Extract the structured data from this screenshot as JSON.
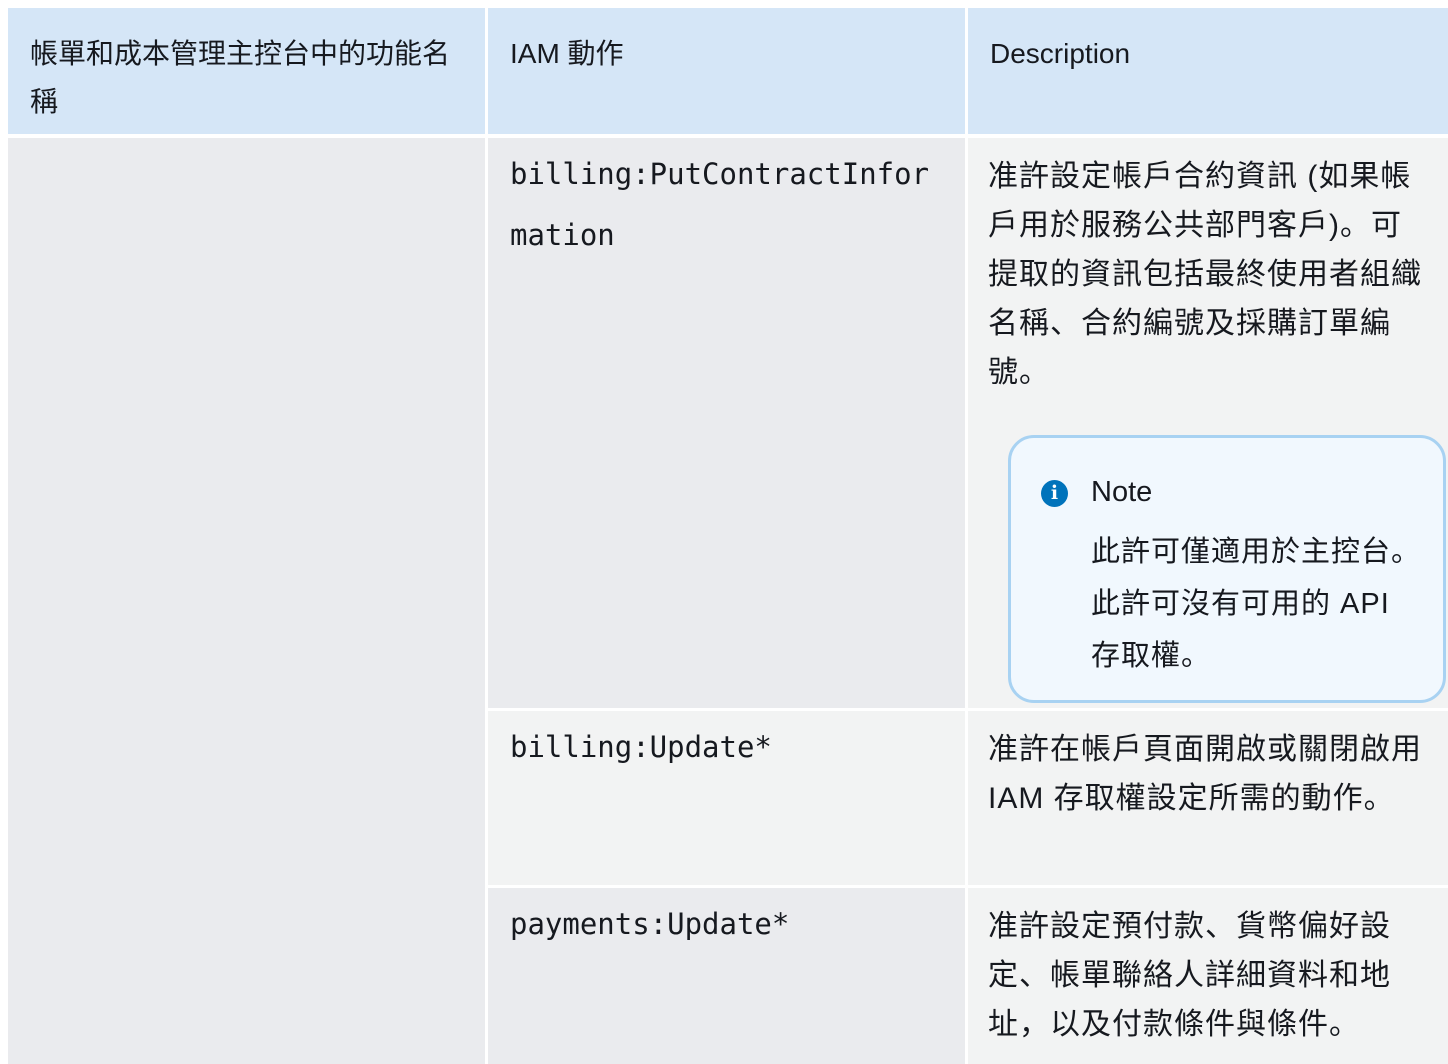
{
  "table": {
    "headers": [
      "帳單和成本管理主控台中的功能名稱",
      "IAM 動作",
      "Description"
    ],
    "rows": [
      {
        "action": "billing:PutContractInformation",
        "description": "准許設定帳戶合約資訊 (如果帳戶用於服務公共部門客戶)。可提取的資訊包括最終使用者組織名稱、合約編號及採購訂單編號。",
        "note": {
          "title": "Note",
          "body": "此許可僅適用於主控台。此許可沒有可用的 API 存取權。"
        }
      },
      {
        "action": "billing:Update*",
        "description": "准許在帳戶頁面開啟或關閉啟用 IAM 存取權設定所需的動作。"
      },
      {
        "action": "payments:Update*",
        "description": "准許設定預付款、貨幣偏好設定、帳單聯絡人詳細資料和地址，以及付款條件與條件。"
      }
    ]
  },
  "icons": {
    "note_icon": "info-circle-icon"
  },
  "colors": {
    "header_bg": "#d5e6f7",
    "row_gray": "#eaebee",
    "row_light": "#f2f3f3",
    "note_bg": "#f1f8fe",
    "note_border": "#a8d2f2",
    "info_icon": "#0073bb"
  }
}
